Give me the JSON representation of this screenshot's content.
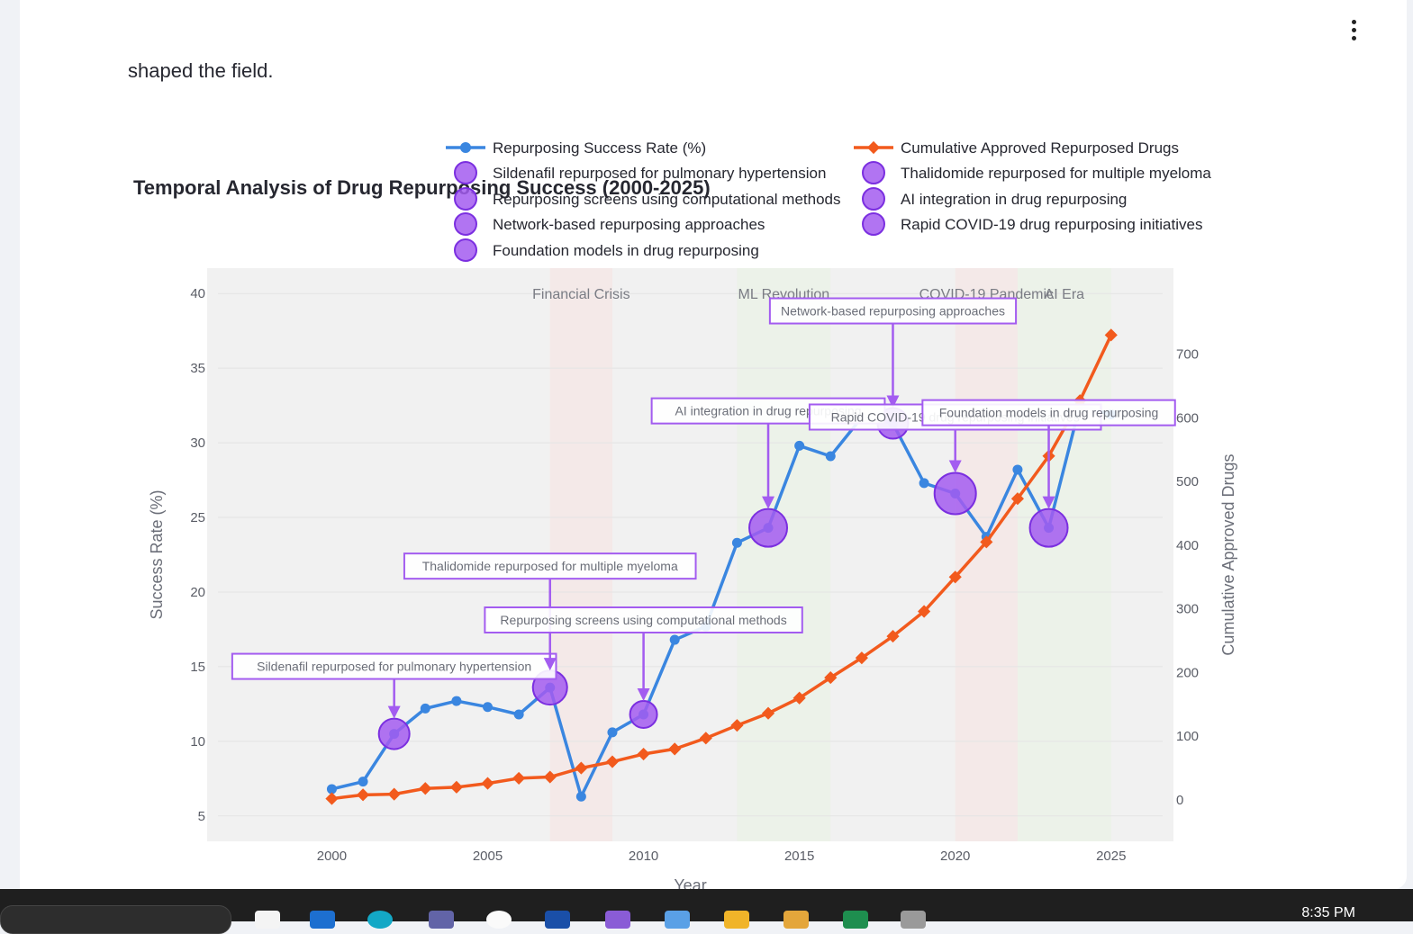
{
  "page": {
    "intro_text": "shaped the field."
  },
  "chart_data": {
    "type": "line",
    "title": "Temporal Analysis of Drug Repurposing Success (2000-2025)",
    "xlabel": "Year",
    "ylabel_left": "Success Rate (%)",
    "ylabel_right": "Cumulative Approved Drugs",
    "x_ticks": [
      2000,
      2005,
      2010,
      2015,
      2020,
      2025
    ],
    "y_left_ticks": [
      5,
      10,
      15,
      20,
      25,
      30,
      35,
      40
    ],
    "y_right_ticks": [
      0,
      100,
      200,
      300,
      400,
      500,
      600,
      700
    ],
    "xlim": [
      1996,
      2027
    ],
    "ylim_left": [
      3.3,
      41.7
    ],
    "ylim_right": [
      -65,
      835
    ],
    "x": [
      2000,
      2001,
      2002,
      2003,
      2004,
      2005,
      2006,
      2007,
      2008,
      2009,
      2010,
      2011,
      2012,
      2013,
      2014,
      2015,
      2016,
      2017,
      2018,
      2019,
      2020,
      2021,
      2022,
      2023,
      2024,
      2025
    ],
    "series": [
      {
        "name": "Repurposing Success Rate (%)",
        "axis": "left",
        "color": "#3a86e0",
        "marker": "circle",
        "values": [
          6.8,
          7.3,
          10.5,
          12.2,
          12.7,
          12.3,
          11.8,
          13.6,
          6.3,
          10.6,
          11.8,
          16.8,
          17.7,
          23.3,
          24.3,
          29.8,
          29.1,
          31.7,
          31.3,
          27.3,
          26.6,
          23.7,
          28.2,
          24.3,
          32.5,
          31.9
        ]
      },
      {
        "name": "Cumulative Approved Repurposed Drugs",
        "axis": "right",
        "color": "#f25a1d",
        "marker": "diamond",
        "values": [
          2,
          8,
          9,
          18,
          20,
          26,
          34,
          36,
          50,
          60,
          72,
          80,
          97,
          117,
          136,
          160,
          192,
          223,
          257,
          296,
          350,
          405,
          473,
          540,
          627,
          730
        ]
      }
    ],
    "events": [
      {
        "name": "Sildenafil repurposed for pulmonary hypertension",
        "year": 2002,
        "y": 10.5,
        "size": 17
      },
      {
        "name": "Thalidomide repurposed for multiple myeloma",
        "year": 2007,
        "y": 13.6,
        "size": 19
      },
      {
        "name": "Repurposing screens using computational methods",
        "year": 2010,
        "y": 11.8,
        "size": 15
      },
      {
        "name": "AI integration in drug repurposing",
        "year": 2014,
        "y": 24.3,
        "size": 21
      },
      {
        "name": "Network-based repurposing approaches",
        "year": 2018,
        "y": 31.3,
        "size": 17
      },
      {
        "name": "Rapid COVID-19 drug repurposing initiatives",
        "year": 2020,
        "y": 26.6,
        "size": 23
      },
      {
        "name": "Foundation models in drug repurposing",
        "year": 2023,
        "y": 24.3,
        "size": 21
      }
    ],
    "periods": [
      {
        "label": "Financial Crisis",
        "start": 2007,
        "end": 2009,
        "color": "#f6e5e2"
      },
      {
        "label": "ML Revolution",
        "start": 2013,
        "end": 2016,
        "color": "#e9f3e4"
      },
      {
        "label": "COVID-19 Pandemic",
        "start": 2020,
        "end": 2022,
        "color": "#f6e5e2"
      },
      {
        "label": "AI Era",
        "start": 2022,
        "end": 2025,
        "color": "#e9f3e4"
      }
    ],
    "legend": [
      {
        "label": "Repurposing Success Rate (%)",
        "kind": "line-circle",
        "color": "#3a86e0"
      },
      {
        "label": "Cumulative Approved Repurposed Drugs",
        "kind": "line-diamond",
        "color": "#f25a1d"
      },
      {
        "label": "Sildenafil repurposed for pulmonary hypertension",
        "kind": "bubble"
      },
      {
        "label": "Thalidomide repurposed for multiple myeloma",
        "kind": "bubble"
      },
      {
        "label": "Repurposing screens using computational methods",
        "kind": "bubble"
      },
      {
        "label": "AI integration in drug repurposing",
        "kind": "bubble"
      },
      {
        "label": "Network-based repurposing approaches",
        "kind": "bubble"
      },
      {
        "label": "Rapid COVID-19 drug repurposing initiatives",
        "kind": "bubble"
      },
      {
        "label": "Foundation models in drug repurposing",
        "kind": "bubble"
      }
    ],
    "legend_placement": "top",
    "grid": true,
    "colors": {
      "bubble_fill": "#a35cf0",
      "bubble_stroke": "#7b2fe0",
      "annotation_border": "#a35cf0",
      "plot_bg": "#f1f1f1"
    }
  },
  "taskbar": {
    "clock": "8:35 PM"
  }
}
